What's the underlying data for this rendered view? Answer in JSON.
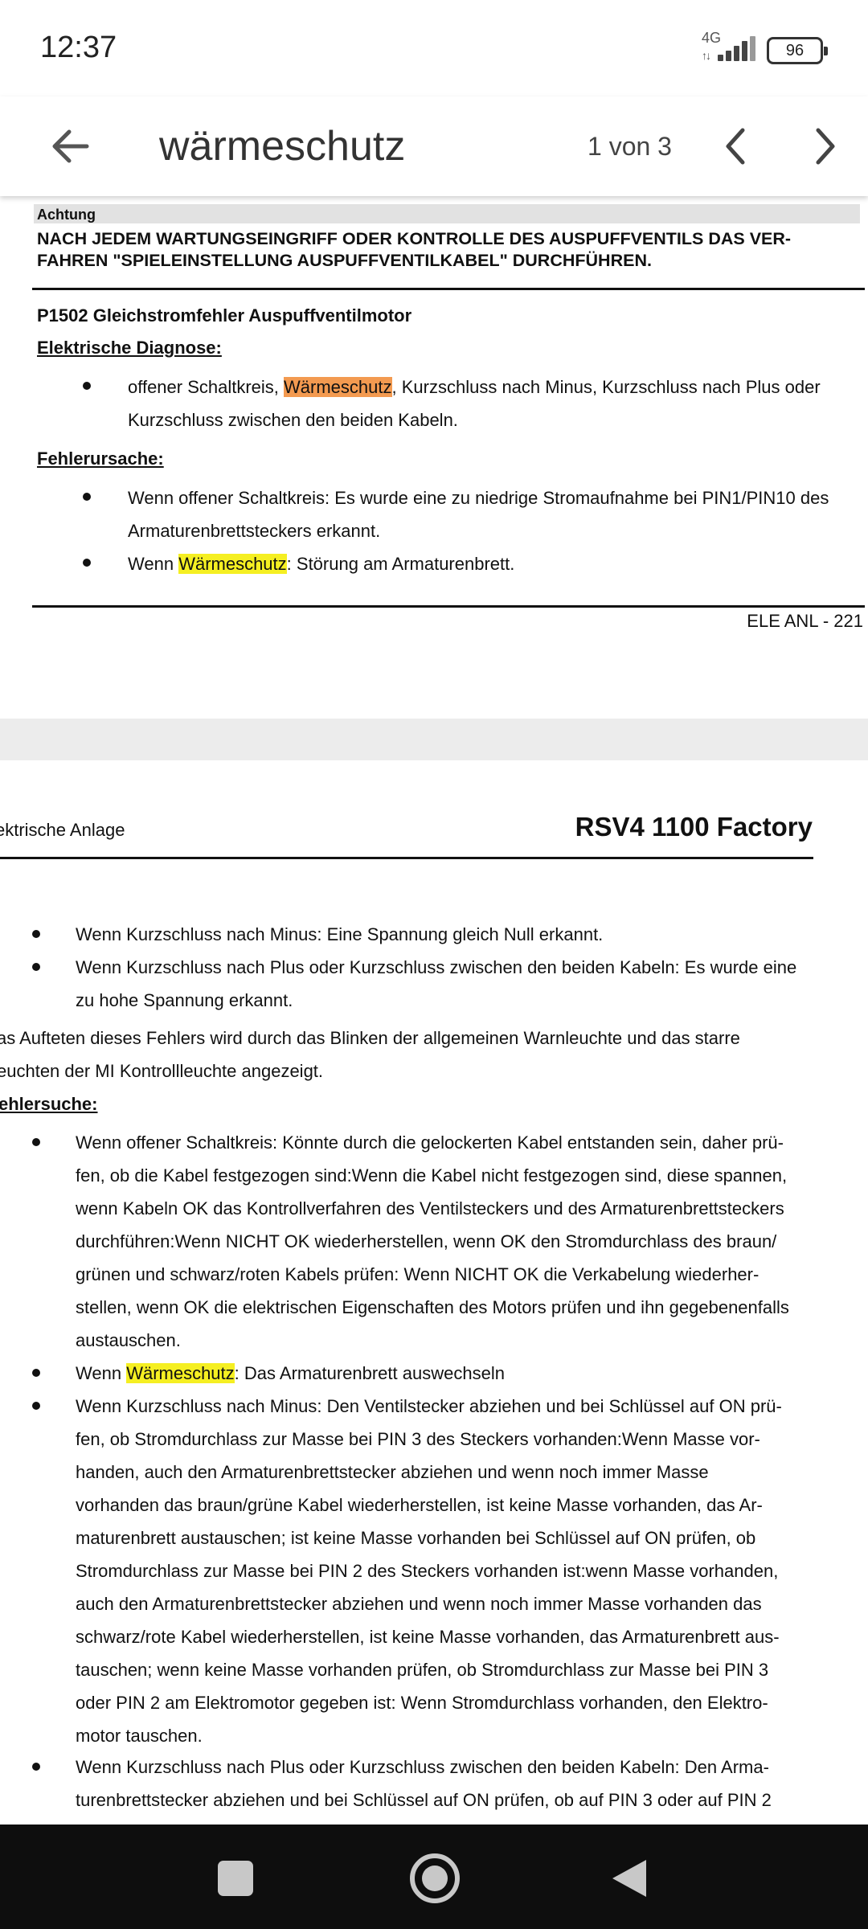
{
  "status": {
    "time": "12:37",
    "network": "4G",
    "battery": "96"
  },
  "search": {
    "query": "wärmeschutz",
    "match_count": "1 von 3"
  },
  "page1": {
    "notice_label": "Achtung",
    "notice_line1": "NACH JEDEM WARTUNGSEINGRIFF ODER KONTROLLE DES AUSPUFFVENTILS DAS VER-",
    "notice_line2": "FAHREN \"SPIELEINSTELLUNG AUSPUFFVENTILKABEL\" DURCHFÜHREN.",
    "error_title": "P1502 Gleichstromfehler Auspuffventilmotor",
    "section_diag": "Elektrische Diagnose:",
    "diag_pre": "offener Schaltkreis, ",
    "diag_hl": "Wärmeschutz",
    "diag_post": ", Kurzschluss nach Minus, Kurzschluss nach Plus oder",
    "diag_line2": "Kurzschluss zwischen den beiden Kabeln.",
    "section_cause": "Fehlerursache:",
    "cause1_line1": "Wenn offener Schaltkreis: Es wurde eine zu niedrige Stromaufnahme bei PIN1/PIN10 des",
    "cause1_line2": "Armaturenbrettsteckers erkannt.",
    "cause2_pre": "Wenn ",
    "cause2_hl": "Wärmeschutz",
    "cause2_post": ": Störung am Armaturenbrett.",
    "page_number": "ELE ANL - 221"
  },
  "page2": {
    "header_left": "ektrische Anlage",
    "header_right": "RSV4 1100 Factory",
    "b1": "Wenn Kurzschluss nach Minus: Eine Spannung gleich Null erkannt.",
    "b2_line1": "Wenn Kurzschluss nach Plus oder Kurzschluss zwischen den beiden Kabeln: Es wurde eine",
    "b2_line2": "zu hohe Spannung erkannt.",
    "para_line1": "as Aufteten dieses Fehlers wird durch das Blinken der allgemeinen Warnleuchte und das starre",
    "para_line2": "euchten der MI Kontrollleuchte angezeigt.",
    "section_search": "ehlersuche:",
    "s1_lines": [
      "Wenn offener Schaltkreis: Könnte durch die gelockerten Kabel entstanden sein, daher prü-",
      "fen, ob die Kabel festgezogen sind:Wenn die Kabel nicht festgezogen sind, diese spannen,",
      "wenn Kabeln OK das Kontrollverfahren des Ventilsteckers und des Armaturenbrettsteckers",
      "durchführen:Wenn NICHT OK wiederherstellen, wenn OK den Stromdurchlass des braun/",
      "grünen und schwarz/roten Kabels prüfen: Wenn NICHT OK die Verkabelung wiederher-",
      "stellen, wenn OK die elektrischen Eigenschaften des Motors prüfen und ihn gegebenenfalls",
      "austauschen."
    ],
    "s2_pre": "Wenn ",
    "s2_hl": "Wärmeschutz",
    "s2_post": ": Das Armaturenbrett auswechseln",
    "s3_lines": [
      "Wenn Kurzschluss nach Minus: Den Ventilstecker abziehen und bei Schlüssel auf ON prü-",
      "fen, ob Stromdurchlass zur Masse bei PIN 3 des Steckers vorhanden:Wenn Masse vor-",
      "handen, auch den Armaturenbrettstecker abziehen und wenn noch immer Masse",
      "vorhanden das braun/grüne Kabel wiederherstellen, ist keine Masse vorhanden, das Ar-",
      "maturenbrett austauschen; ist keine Masse vorhanden bei Schlüssel auf ON prüfen, ob",
      "Stromdurchlass zur Masse bei PIN 2 des Steckers vorhanden ist:wenn Masse vorhanden,",
      "auch den Armaturenbrettstecker abziehen und wenn noch immer Masse vorhanden das",
      "schwarz/rote Kabel wiederherstellen, ist keine Masse vorhanden, das Armaturenbrett aus-",
      "tauschen; wenn keine Masse vorhanden prüfen, ob Stromdurchlass zur Masse bei PIN 3",
      "oder PIN 2 am Elektromotor gegeben ist: Wenn Stromdurchlass vorhanden, den Elektro-",
      "motor tauschen."
    ],
    "s4_lines": [
      "Wenn Kurzschluss nach Plus oder Kurzschluss zwischen den beiden Kabeln: Den Arma-",
      "turenbrettstecker abziehen und bei Schlüssel auf ON prüfen, ob auf PIN 3 oder auf PIN 2"
    ]
  },
  "colors": {
    "highlight": "#f5ef22",
    "highlight_current": "#f39a50"
  }
}
